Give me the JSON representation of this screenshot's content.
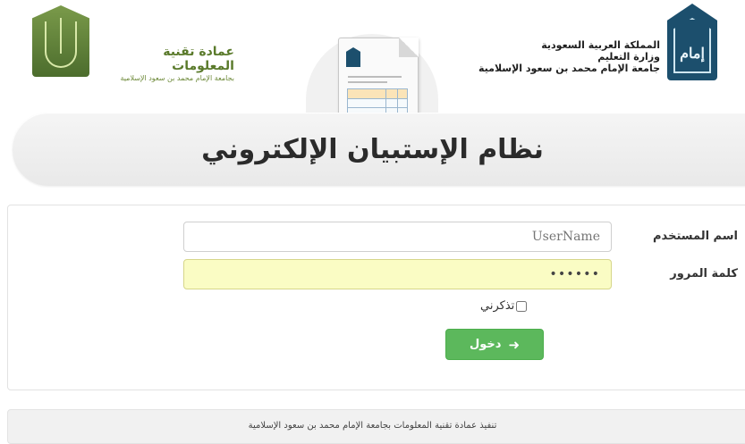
{
  "header": {
    "ministry_lines": [
      "المملكة العربية السعودية",
      "وزارة التعليم",
      "جامعة الإمام محمد بن سعود الإسلامية"
    ],
    "right_logo_text": "إمام",
    "it_dept_title": "عمادة تقنية المعلومات",
    "it_dept_subtitle": "بجامعة الإمام محمد بن سعود الإسلامية"
  },
  "title": "نظام الإستبيان الإلكتروني",
  "form": {
    "username_label": "اسم المستخدم",
    "username_placeholder": "UserName",
    "password_label": "كلمة المرور",
    "password_value": "••••••",
    "remember_label": "تذكرني",
    "remember_checked": false,
    "login_label": "دخول",
    "login_icon": "sign-in-icon"
  },
  "footer": {
    "text": "تنفيذ عمادة تقنية المعلومات بجامعة الإمام محمد بن سعود الإسلامية"
  },
  "colors": {
    "login_button": "#5cb85c",
    "password_bg": "#fafcc4",
    "it_green": "#5a7a2b",
    "university_blue": "#1c4f6d"
  }
}
